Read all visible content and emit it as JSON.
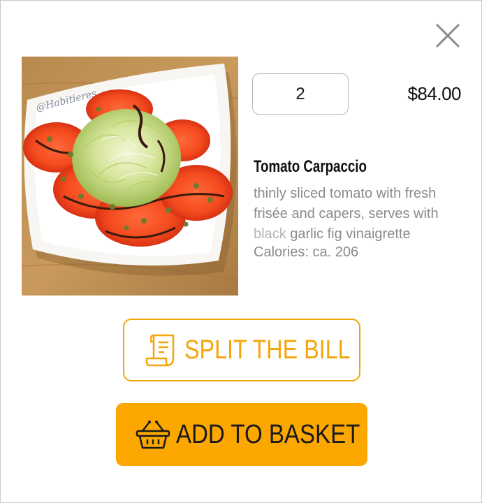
{
  "dialog": {
    "close_icon": "close-icon",
    "quantity_value": "2",
    "price": "$84.00",
    "product": {
      "name": "Tomato Carpaccio",
      "description_part1": "thinly sliced tomato with fresh frisée and capers, serves with",
      "description_part2": "black",
      "description_part3": "garlic fig vinaigrette",
      "calories": "Calories: ca. 206",
      "image_text": "@Habitieres"
    },
    "split_bill": {
      "label": "SPLIT THE BILL",
      "icon": "receipt-icon"
    },
    "add_to_basket": {
      "label": "ADD TO BASKET",
      "icon": "basket-icon"
    },
    "colors": {
      "accent": "#fba700",
      "accent_outline": "#f5a50a",
      "text_dark": "#111111",
      "text_muted": "#8a8a8a"
    }
  }
}
